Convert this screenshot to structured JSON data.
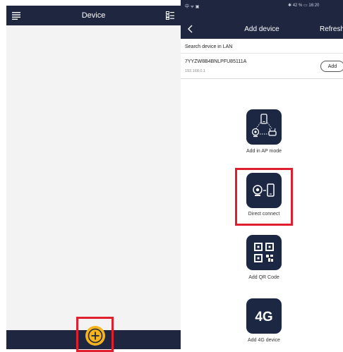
{
  "left_screen": {
    "title": "Device"
  },
  "right_screen": {
    "status_left": "中 ᯤ ▣",
    "status_right": "✱ 42 % ▭ 16:20",
    "nav": {
      "title": "Add device",
      "refresh_label": "Refresh"
    },
    "lan": {
      "section_label": "Search device in LAN",
      "device_id": "7YYZW8B4BNLPFU85111A",
      "device_ip": "192.168.0.1",
      "add_label": "Add"
    },
    "options": [
      {
        "label": "Add in AP mode",
        "icon": "ap-mode-icon"
      },
      {
        "label": "Direct connect",
        "icon": "direct-connect-icon"
      },
      {
        "label": "Add QR Code",
        "icon": "qr-code-icon"
      },
      {
        "label": "Add 4G device",
        "icon": "4g-icon"
      }
    ]
  },
  "colors": {
    "nav_bar": "#1f2640",
    "option_tile": "#1c2744",
    "fab": "#f6b41a",
    "highlight": "#e01f2e"
  }
}
